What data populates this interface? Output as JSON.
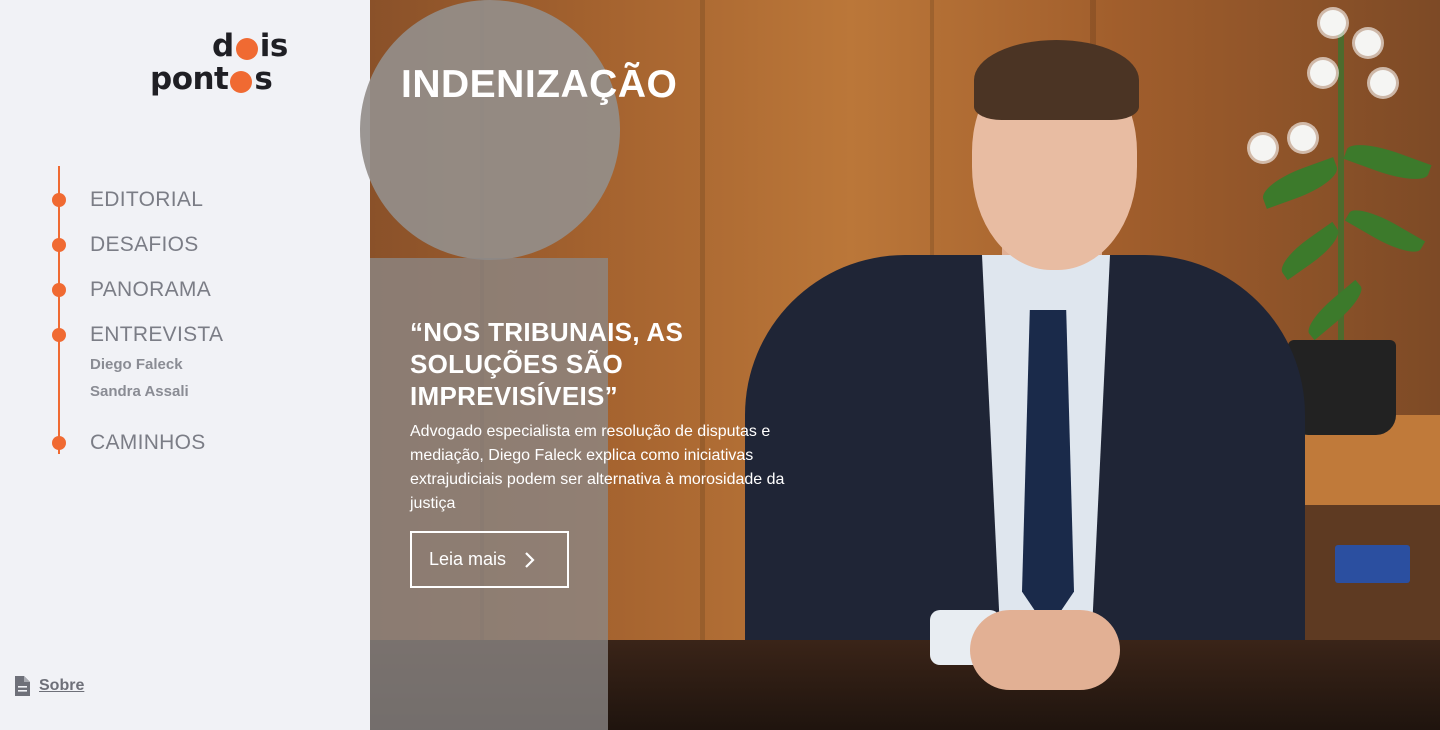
{
  "brand": {
    "logo_line1": [
      "d",
      "is"
    ],
    "logo_line2": [
      "pont",
      "s"
    ],
    "accent_color": "#f06a32",
    "text_color": "#1f1f24"
  },
  "nav": {
    "items": [
      {
        "label": "EDITORIAL"
      },
      {
        "label": "DESAFIOS"
      },
      {
        "label": "PANORAMA"
      },
      {
        "label": "ENTREVISTA",
        "sub": [
          "Diego Faleck",
          "Sandra Assali"
        ]
      },
      {
        "label": "CAMINHOS"
      }
    ]
  },
  "footer": {
    "about_label": "Sobre",
    "about_icon": "document-icon"
  },
  "hero": {
    "category": "INDENIZAÇÃO",
    "headline": "“NOS TRIBUNAIS, AS SOLUÇÕES SÃO IMPREVISÍVEIS”",
    "summary": "Advogado especialista em resolução de disputas e mediação, Diego Faleck explica como iniciativas extrajudiciais podem ser alternativa à morosidade da justiça",
    "cta_label": "Leia mais",
    "cta_icon": "chevron-right-icon"
  }
}
